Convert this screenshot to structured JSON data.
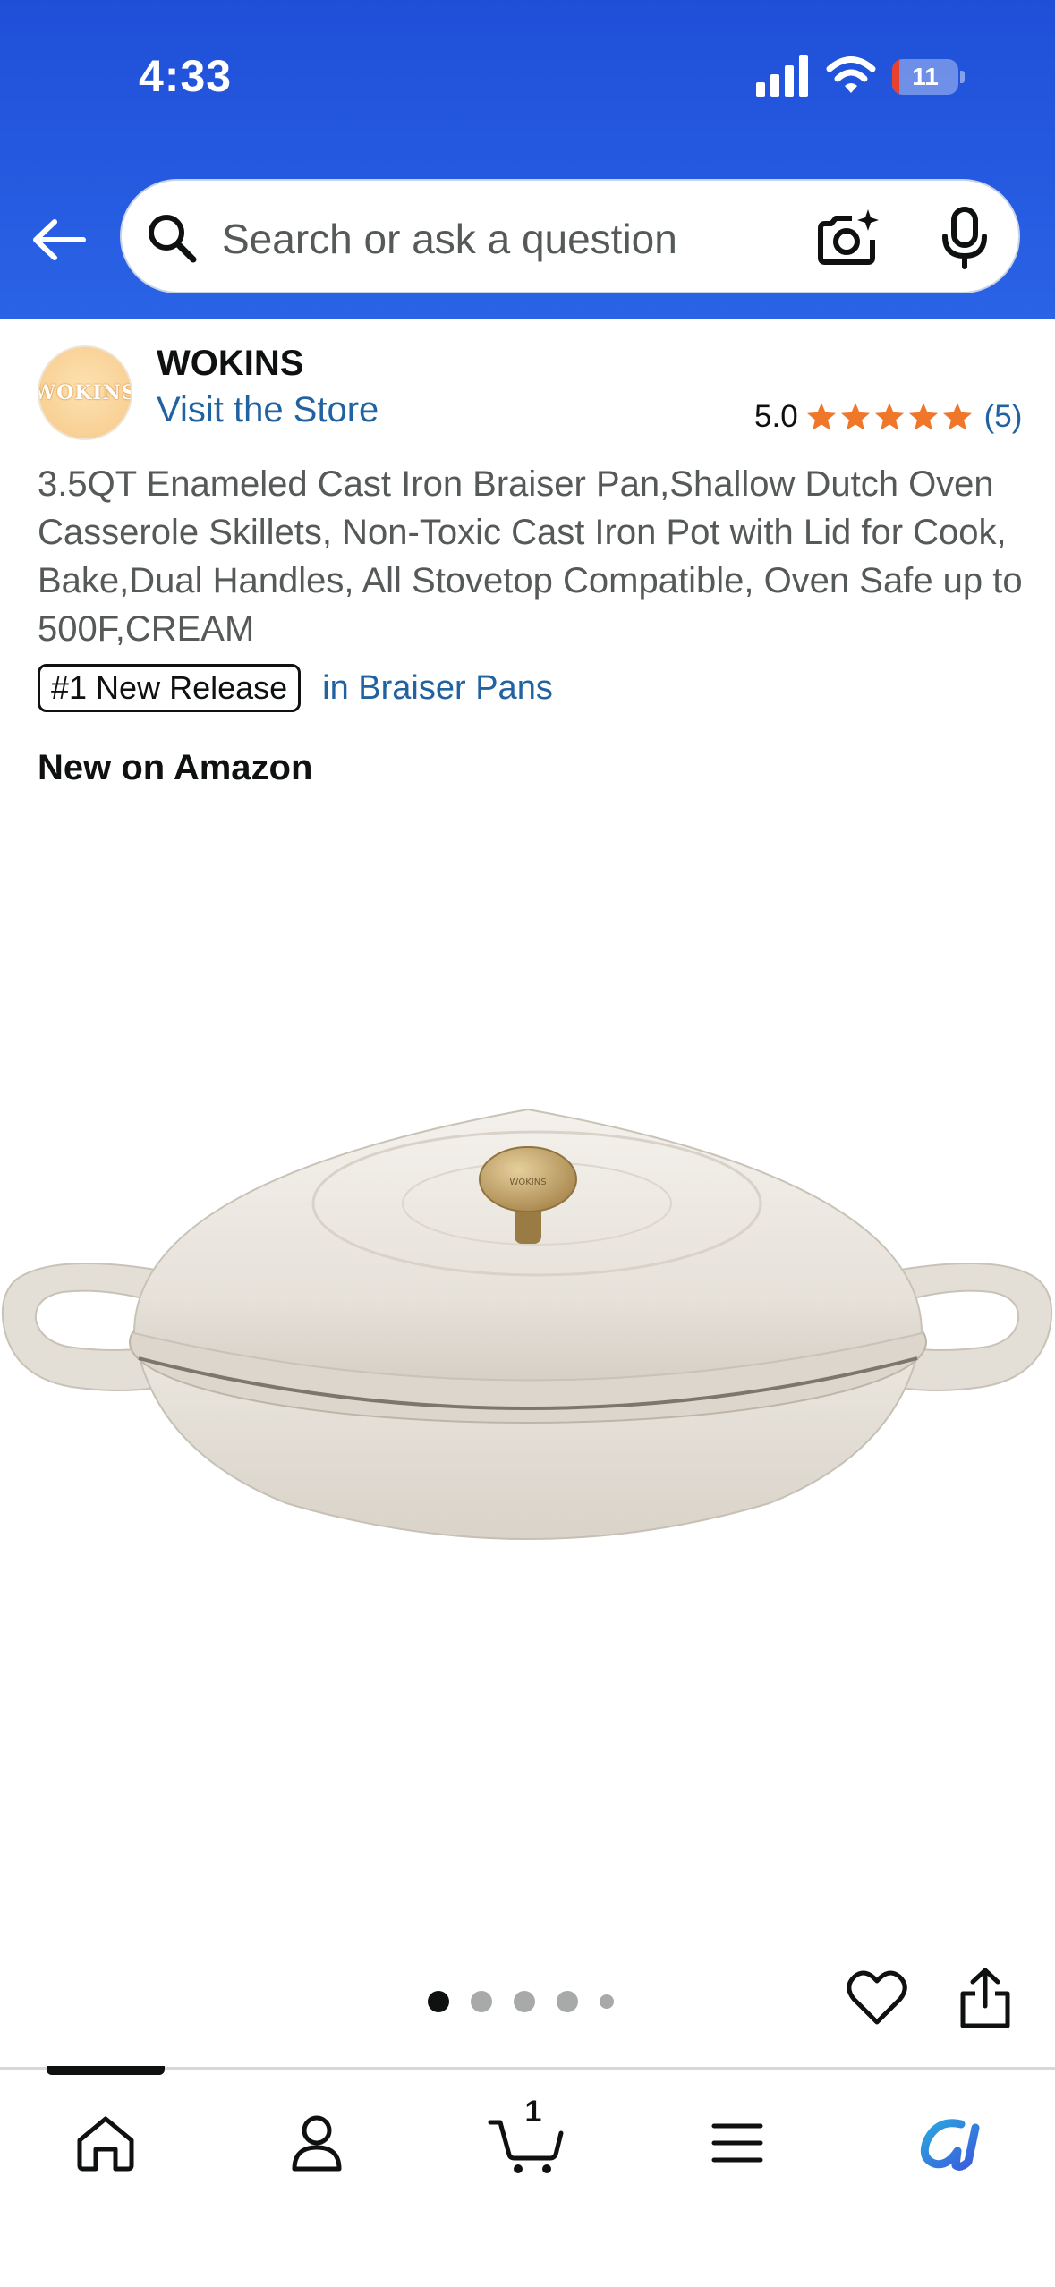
{
  "status_bar": {
    "time": "4:33",
    "battery_level": "11",
    "battery_fraction": 0.11
  },
  "search": {
    "placeholder": "Search or ask a question"
  },
  "brand": {
    "logo_text": "WOKINS",
    "name": "WOKINS",
    "store_link": "Visit the Store"
  },
  "rating": {
    "value": "5.0",
    "stars": 5,
    "count": "(5)"
  },
  "product": {
    "title": "3.5QT Enameled Cast Iron Braiser Pan,Shallow Dutch Oven Casserole Skillets, Non-Toxic Cast Iron Pot with Lid for Cook, Bake,Dual Handles, All Stovetop Compatible, Oven Safe up to 500F,CREAM",
    "badge": "#1 New Release",
    "badge_category": "in Braiser Pans",
    "new_on": "New on Amazon",
    "lid_knob_text": "WOKINS"
  },
  "carousel": {
    "total_images": 5,
    "active_index": 0
  },
  "bottom_nav": {
    "items": [
      {
        "name": "home",
        "icon": "home-icon"
      },
      {
        "name": "account",
        "icon": "person-icon"
      },
      {
        "name": "cart",
        "icon": "cart-icon",
        "count": "1"
      },
      {
        "name": "menu",
        "icon": "hamburger-icon"
      },
      {
        "name": "rufus",
        "icon": "rufus-icon"
      }
    ]
  },
  "colors": {
    "header_blue": "#1f4fd8",
    "link_blue": "#2162a1",
    "star_orange": "#f0762a",
    "battery_red": "#e8412f",
    "text_dark": "#0f1111",
    "text_gray": "#565959"
  }
}
